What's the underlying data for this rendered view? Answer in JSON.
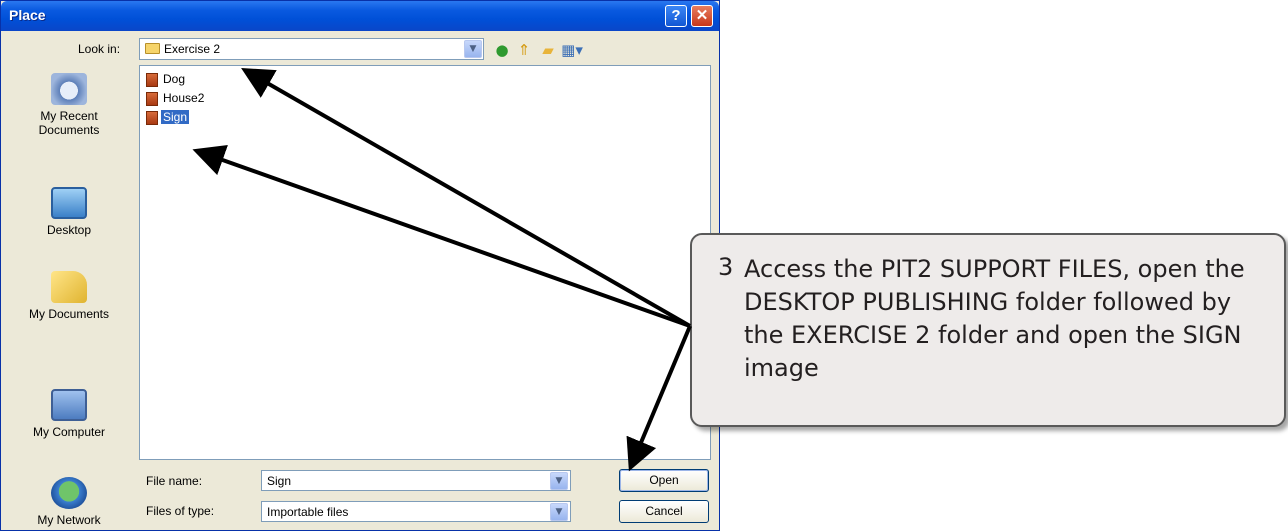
{
  "dialog": {
    "title": "Place",
    "help_glyph": "?",
    "close_glyph": "✕"
  },
  "look_in": {
    "label": "Look in:",
    "value": "Exercise 2"
  },
  "toolbar": {
    "icons": [
      "back-icon",
      "up-folder-icon",
      "new-folder-icon",
      "views-menu-icon"
    ]
  },
  "places": [
    {
      "label": "My Recent\nDocuments",
      "icon": "recent-documents-icon"
    },
    {
      "label": "Desktop",
      "icon": "desktop-icon"
    },
    {
      "label": "My Documents",
      "icon": "my-documents-icon"
    },
    {
      "label": "My Computer",
      "icon": "my-computer-icon"
    },
    {
      "label": "My Network",
      "icon": "my-network-icon"
    }
  ],
  "files": [
    {
      "name": "Dog",
      "selected": false
    },
    {
      "name": "House2",
      "selected": false
    },
    {
      "name": "Sign",
      "selected": true
    }
  ],
  "file_name": {
    "label": "File name:",
    "value": "Sign"
  },
  "file_type": {
    "label": "Files of type:",
    "value": "Importable files"
  },
  "buttons": {
    "open": "Open",
    "cancel": "Cancel"
  },
  "callout": {
    "number": "3",
    "text": "Access the PIT2 SUPPORT FILES, open the DESKTOP PUBLISHING folder followed by the EXERCISE 2 folder and open the SIGN image"
  },
  "colors": {
    "titlebar": "#0a5ae0",
    "dialog_bg": "#ece9d8",
    "selection": "#316ac5",
    "callout_border": "#595959"
  }
}
